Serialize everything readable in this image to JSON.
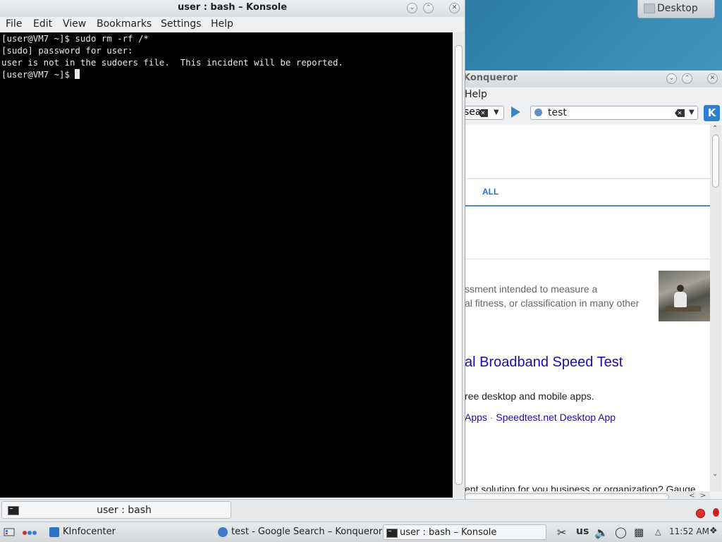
{
  "desktop": {
    "widget_label": "Desktop"
  },
  "konsole": {
    "title": "user : bash – Konsole",
    "menu": [
      "File",
      "Edit",
      "View",
      "Bookmarks",
      "Settings",
      "Help"
    ],
    "terminal_lines": [
      "[user@VM7 ~]$ sudo rm -rf /*",
      "[sudo] password for user:",
      "user is not in the sudoers file.  This incident will be reported.",
      "[user@VM7 ~]$ "
    ],
    "tab_label": "user : bash"
  },
  "konqueror": {
    "title": "Konqueror",
    "menu_help": "Help",
    "search_combo_text": "sea",
    "url_text": "test",
    "page": {
      "tab_all": "ALL",
      "snippet_line1": "ssment intended to measure a",
      "snippet_line2": "al fitness, or classification in many other",
      "result_title": "al Broadband Speed Test",
      "result_desc": "ree desktop and mobile apps.",
      "sitelink1": "Apps",
      "sitelink_sep": " · ",
      "sitelink2": "Speedtest.net Desktop App",
      "cut_text": "ent solution for you business or organization? Gauge"
    }
  },
  "taskbar": {
    "tasks": [
      {
        "label": "KInfocenter",
        "icon": "kinfocenter-icon"
      },
      {
        "label": "test - Google Search – Konqueror",
        "icon": "konqueror-icon"
      },
      {
        "label": "user : bash – Konsole",
        "icon": "konsole-icon"
      }
    ],
    "keyboard_layout": "us",
    "clock": "11:52 AM"
  },
  "colors": {
    "link": "#1a0dab",
    "tab_blue": "#1a73e8",
    "terminal_bg": "#000000",
    "terminal_fg": "#e8e8e8"
  }
}
